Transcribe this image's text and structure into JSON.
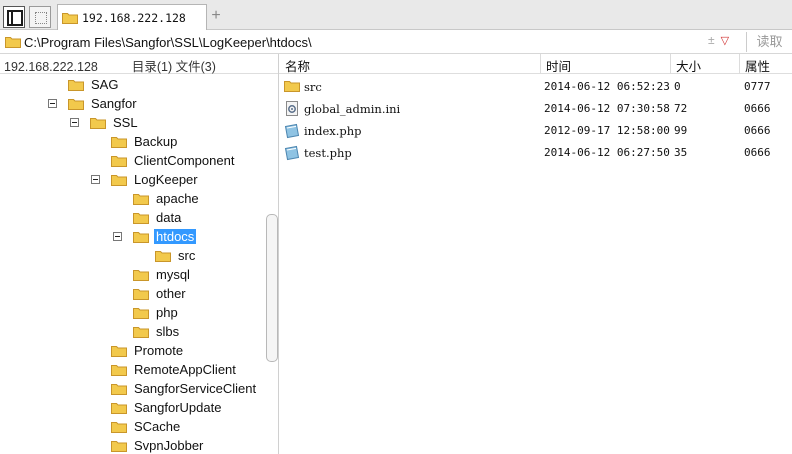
{
  "tabs": {
    "active_tab_label": "192.168.222.128",
    "new_tab_symbol": "+"
  },
  "path_bar": {
    "path": "C:\\Program Files\\Sangfor\\SSL\\LogKeeper\\htdocs\\",
    "menu_symbol": "±",
    "menu_arrow": "▽",
    "read_label": "读取"
  },
  "status": {
    "host": "192.168.222.128",
    "summary": "目录(1) 文件(3)"
  },
  "columns": {
    "name": "名称",
    "time": "时间",
    "size": "大小",
    "attr": "属性"
  },
  "tree": [
    {
      "label": "SAG",
      "toggle": false,
      "selected": false
    },
    {
      "label": "Sangfor",
      "toggle": true,
      "selected": false
    },
    {
      "label": "SSL",
      "toggle": true,
      "selected": false
    },
    {
      "label": "Backup",
      "toggle": false,
      "selected": false
    },
    {
      "label": "ClientComponent",
      "toggle": false,
      "selected": false
    },
    {
      "label": "LogKeeper",
      "toggle": true,
      "selected": false
    },
    {
      "label": "apache",
      "toggle": false,
      "selected": false
    },
    {
      "label": "data",
      "toggle": false,
      "selected": false
    },
    {
      "label": "htdocs",
      "toggle": true,
      "selected": true
    },
    {
      "label": "src",
      "toggle": false,
      "selected": false
    },
    {
      "label": "mysql",
      "toggle": false,
      "selected": false
    },
    {
      "label": "other",
      "toggle": false,
      "selected": false
    },
    {
      "label": "php",
      "toggle": false,
      "selected": false
    },
    {
      "label": "slbs",
      "toggle": false,
      "selected": false
    },
    {
      "label": "Promote",
      "toggle": false,
      "selected": false
    },
    {
      "label": "RemoteAppClient",
      "toggle": false,
      "selected": false
    },
    {
      "label": "SangforServiceClient",
      "toggle": false,
      "selected": false
    },
    {
      "label": "SangforUpdate",
      "toggle": false,
      "selected": false
    },
    {
      "label": "SCache",
      "toggle": false,
      "selected": false
    },
    {
      "label": "SvpnJobber",
      "toggle": false,
      "selected": false
    }
  ],
  "files": [
    {
      "name": "src",
      "time": "2014-06-12 06:52:23",
      "size": "0",
      "attr": "0777",
      "icon": "folder-icon"
    },
    {
      "name": "global_admin.ini",
      "time": "2014-06-12 07:30:58",
      "size": "72",
      "attr": "0666",
      "icon": "settings-file-icon"
    },
    {
      "name": "index.php",
      "time": "2012-09-17 12:58:00",
      "size": "99",
      "attr": "0666",
      "icon": "php-file-icon"
    },
    {
      "name": "test.php",
      "time": "2014-06-12 06:27:50",
      "size": "35",
      "attr": "0666",
      "icon": "php-file-icon"
    }
  ],
  "colors": {
    "selection": "#3399ff",
    "folder": "#f2c94c",
    "folder_border": "#c9962a"
  }
}
